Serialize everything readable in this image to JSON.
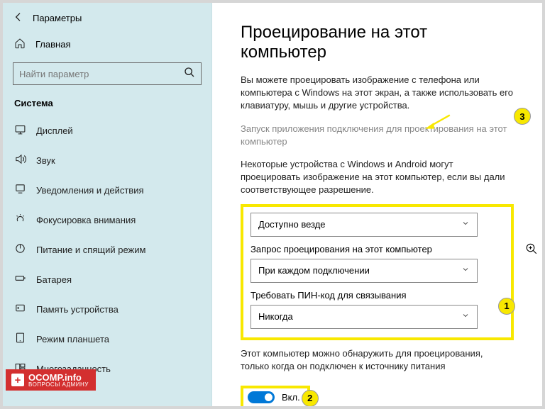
{
  "header": {
    "title": "Параметры"
  },
  "sidebar": {
    "home": "Главная",
    "searchPlaceholder": "Найти параметр",
    "sectionTitle": "Система",
    "items": [
      {
        "label": "Дисплей"
      },
      {
        "label": "Звук"
      },
      {
        "label": "Уведомления и действия"
      },
      {
        "label": "Фокусировка внимания"
      },
      {
        "label": "Питание и спящий режим"
      },
      {
        "label": "Батарея"
      },
      {
        "label": "Память устройства"
      },
      {
        "label": "Режим планшета"
      },
      {
        "label": "Многозадачность"
      }
    ]
  },
  "main": {
    "title": "Проецирование на этот компьютер",
    "desc": "Вы можете проецировать изображение с телефона или компьютера с Windows на этот экран, а также использовать его клавиатуру, мышь и другие устройства.",
    "linkText": "Запуск приложения подключения для проектирования на этот компьютер",
    "sub": "Некоторые устройства с Windows и Android могут проецировать изображение на этот компьютер, если вы дали соответствующее разрешение.",
    "dd1": {
      "value": "Доступно везде"
    },
    "dd2": {
      "label": "Запрос проецирования на этот компьютер",
      "value": "При каждом подключении"
    },
    "dd3": {
      "label": "Требовать ПИН-код для связывания",
      "value": "Никогда"
    },
    "toggleDesc": "Этот компьютер можно обнаружить для проецирования, только когда он подключен к источнику питания",
    "toggleLabel": "Вкл."
  },
  "badges": {
    "b1": "1",
    "b2": "2",
    "b3": "3"
  },
  "watermark": {
    "main": "OCOMP.info",
    "sub": "ВОПРОСЫ АДМИНУ"
  }
}
